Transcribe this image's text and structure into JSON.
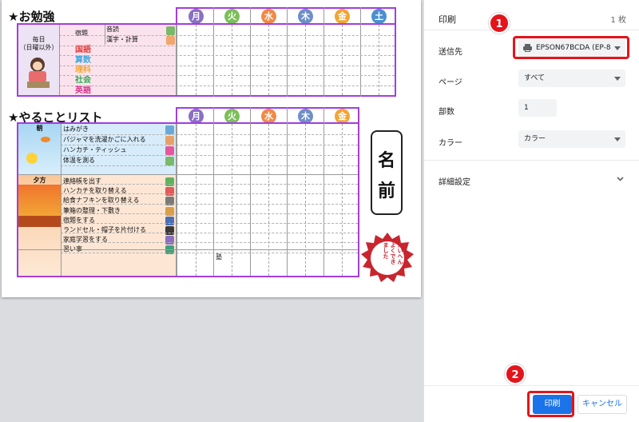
{
  "study": {
    "title": "★お勉強",
    "days": [
      "月",
      "火",
      "水",
      "木",
      "金",
      "土"
    ],
    "day_colors": [
      "#8a6fc3",
      "#7cbf5a",
      "#f08a45",
      "#6e8fc6",
      "#f2a530",
      "#4b8fd0"
    ],
    "side_label": "毎日\n（日曜以外）",
    "homework_label": "宿題",
    "homework_items": [
      "音読",
      "漢字・計算"
    ],
    "subjects": [
      {
        "name": "国語",
        "color": "#e23b3b"
      },
      {
        "name": "算数",
        "color": "#3fa8e0"
      },
      {
        "name": "理科",
        "color": "#f2a530"
      },
      {
        "name": "社会",
        "color": "#32a852"
      },
      {
        "name": "英語",
        "color": "#d6338a"
      }
    ]
  },
  "todo": {
    "title": "★やることリスト",
    "days": [
      "月",
      "火",
      "水",
      "木",
      "金"
    ],
    "morning_label": "朝",
    "evening_label": "夕方",
    "morning_items": [
      "はみがき",
      "パジャマを洗濯かごに入れる",
      "ハンカチ・ティッシュ",
      "体温を測る"
    ],
    "evening_items": [
      "連絡帳を出す",
      "ハンカチを取り替える",
      "給食ナフキンを取り替える",
      "筆箱の整理・下敷き",
      "宿題をする",
      "ランドセル・帽子を片付ける",
      "家庭学習をする",
      "習い事"
    ],
    "juku_note": "塾"
  },
  "name_box": {
    "line1": "名",
    "line2": "前"
  },
  "stamp": {
    "text": "たいへん\nよくでき\nました",
    "color": "#c8252f"
  },
  "panel": {
    "header_title": "印刷",
    "sheet_count": "1 枚",
    "destination_label": "送信先",
    "destination_value": "EPSON67BCDA (EP-8",
    "pages_label": "ページ",
    "pages_value": "すべて",
    "copies_label": "部数",
    "copies_value": "1",
    "color_label": "カラー",
    "color_value": "カラー",
    "more_settings_label": "詳細設定",
    "print_button": "印刷",
    "cancel_button": "キャンセル",
    "accent_color": "#1a73e8"
  },
  "callouts": [
    {
      "number": "1",
      "target": "destination-select"
    },
    {
      "number": "2",
      "target": "print-button"
    }
  ]
}
